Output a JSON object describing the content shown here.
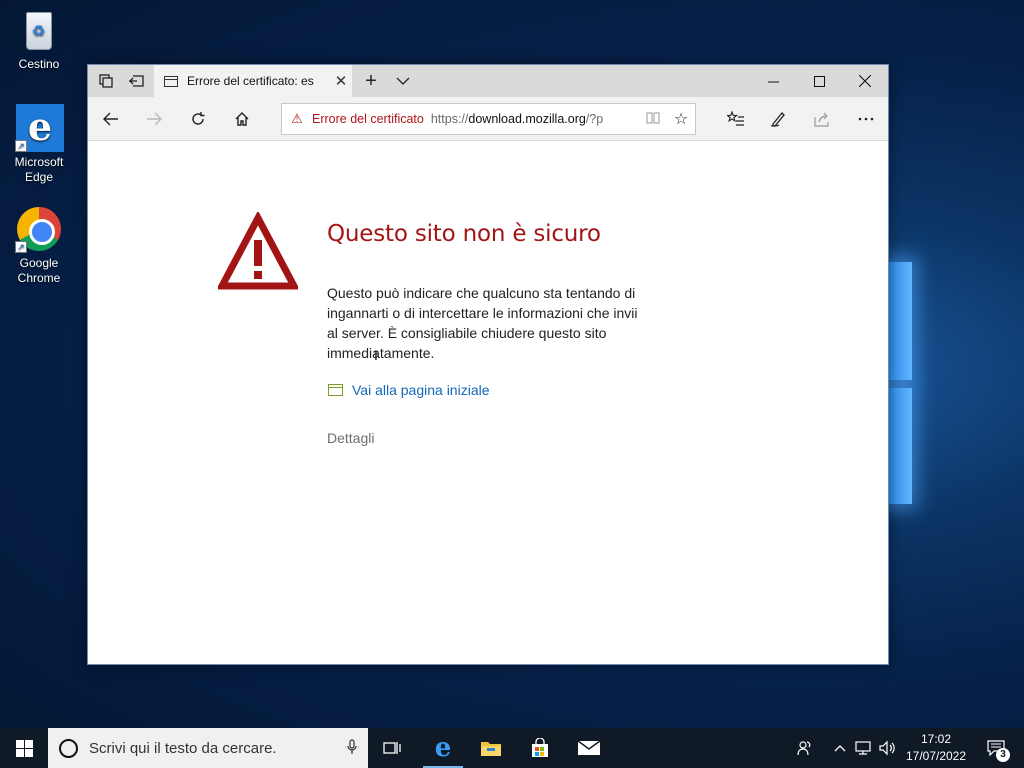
{
  "desktop": {
    "icons": [
      {
        "label": "Cestino"
      },
      {
        "label": "Microsoft Edge"
      },
      {
        "label": "Google Chrome"
      }
    ]
  },
  "browser": {
    "tab": {
      "title": "Errore del certificato: es",
      "icon": "page-icon"
    },
    "titlebar_icons": [
      "tab-set-aside-icon",
      "show-tabs-icon",
      "new-tab-icon",
      "tab-preview-icon"
    ],
    "window_controls": [
      "minimize-icon",
      "maximize-icon",
      "close-icon"
    ],
    "nav": {
      "back_icon": "arrow-left-icon",
      "forward_icon": "arrow-right-icon",
      "refresh_icon": "refresh-icon",
      "home_icon": "home-icon"
    },
    "address": {
      "error_label": "Errore del certificato",
      "url_prefix": "https://",
      "url_host": "download.mozilla.org",
      "url_rest": "/?p",
      "warning_color": "#b0141a"
    },
    "toolbar_icons": [
      "favorites-icon",
      "notes-icon",
      "share-icon",
      "more-icon"
    ]
  },
  "page": {
    "title": "Questo sito non è sicuro",
    "body_lines": [
      "Questo può indicare che qualcuno sta tentando di",
      "ingannarti o di intercettare le informazioni che invii",
      "al server. È consigliabile chiudere questo sito",
      "immediatamente."
    ],
    "home_link": "Vai alla pagina iniziale",
    "details": "Dettagli",
    "title_color": "#a31515"
  },
  "taskbar": {
    "search_placeholder": "Scrivi qui il testo da cercare.",
    "apps": [
      "task-view-icon",
      "edge-icon",
      "file-explorer-icon",
      "store-icon",
      "mail-icon"
    ],
    "clock": {
      "time": "17:02",
      "date": "17/07/2022"
    },
    "notification_count": "3"
  }
}
